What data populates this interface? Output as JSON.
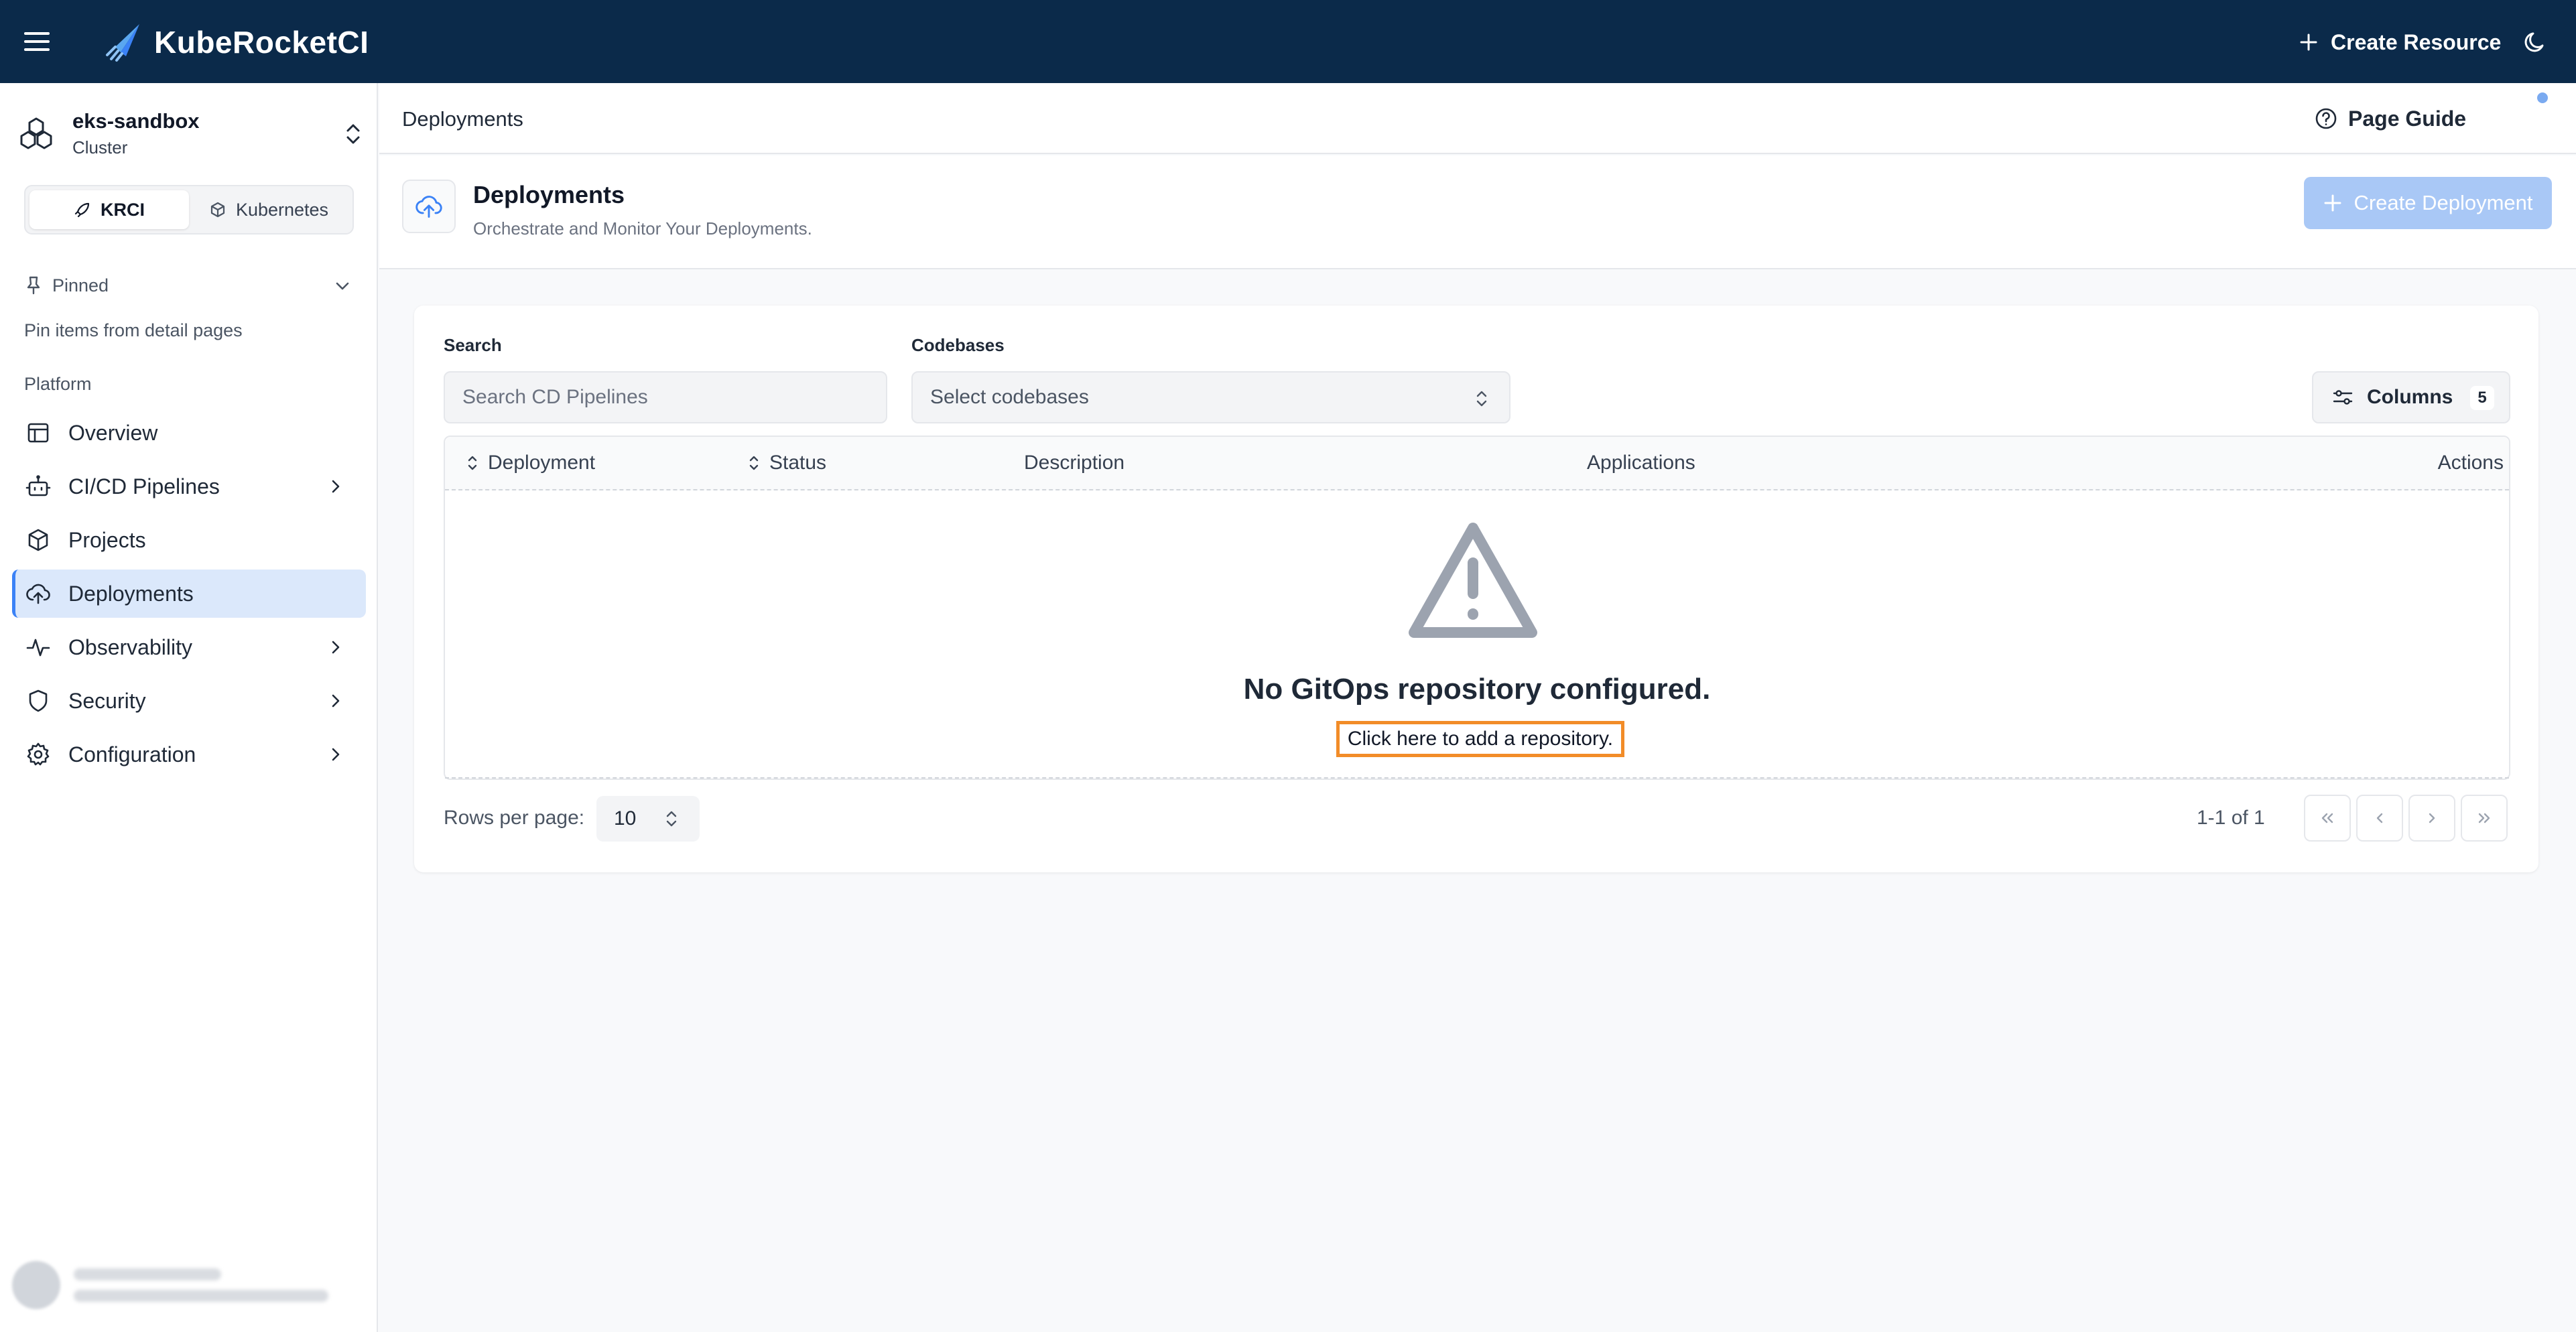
{
  "app": {
    "title": "KubeRocketCI",
    "create_resource_label": "Create Resource"
  },
  "sidebar": {
    "cluster": {
      "name": "eks-sandbox",
      "type": "Cluster"
    },
    "switcher": [
      {
        "label": "KRCI",
        "active": true
      },
      {
        "label": "Kubernetes",
        "active": false
      }
    ],
    "pinned": {
      "label": "Pinned",
      "hint": "Pin items from detail pages"
    },
    "section_label": "Platform",
    "items": [
      {
        "label": "Overview",
        "icon": "layout-icon",
        "has_children": false
      },
      {
        "label": "CI/CD Pipelines",
        "icon": "bot-icon",
        "has_children": true
      },
      {
        "label": "Projects",
        "icon": "box-icon",
        "has_children": false
      },
      {
        "label": "Deployments",
        "icon": "cloud-upload-icon",
        "has_children": false,
        "active": true
      },
      {
        "label": "Observability",
        "icon": "activity-icon",
        "has_children": true
      },
      {
        "label": "Security",
        "icon": "shield-icon",
        "has_children": true
      },
      {
        "label": "Configuration",
        "icon": "gear-icon",
        "has_children": true
      }
    ]
  },
  "breadcrumb": {
    "current": "Deployments"
  },
  "page_guide_label": "Page Guide",
  "page_header": {
    "title": "Deployments",
    "subtitle": "Orchestrate and Monitor Your Deployments.",
    "create_button_label": "Create Deployment"
  },
  "filters": {
    "search_label": "Search",
    "search_placeholder": "Search CD Pipelines",
    "search_value": "",
    "codebases_label": "Codebases",
    "codebases_placeholder": "Select codebases",
    "columns_label": "Columns",
    "columns_count": "5"
  },
  "table": {
    "columns": [
      "Deployment",
      "Status",
      "Description",
      "Applications",
      "Actions"
    ],
    "empty_title": "No GitOps repository configured.",
    "empty_action": "Click here to add a repository."
  },
  "pagination": {
    "rows_per_page_label": "Rows per page:",
    "rows_per_page": "10",
    "range_text": "1-1 of 1"
  },
  "colors": {
    "topbar": "#0b2a4a",
    "accent": "#3b82f6",
    "highlight": "#f28c28"
  }
}
